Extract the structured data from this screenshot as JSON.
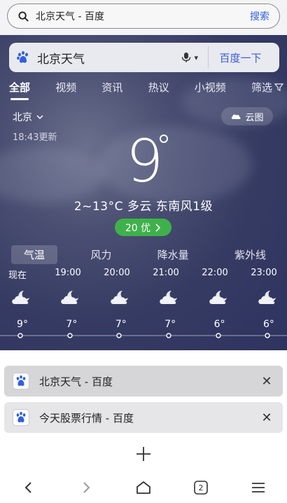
{
  "browser": {
    "address_text": "北京天气 - 百度",
    "search_label": "搜索",
    "tab_count": "2"
  },
  "baidu": {
    "query": "北京天气",
    "search_button": "百度一下",
    "tabs": [
      "全部",
      "视频",
      "资讯",
      "热议",
      "小视频",
      "筛选"
    ],
    "active_tab": "全部"
  },
  "weather": {
    "city": "北京",
    "updated": "18:43更新",
    "cloud_map": "云图",
    "temperature": "9",
    "condition": "2~13°C  多云  东南风1级",
    "aqi": "20 优",
    "metric_tabs": [
      "气温",
      "风力",
      "降水量",
      "紫外线"
    ],
    "active_metric": "气温",
    "hourly": [
      {
        "time": "现在",
        "temp": "9°"
      },
      {
        "time": "19:00",
        "temp": "7°"
      },
      {
        "time": "20:00",
        "temp": "7°"
      },
      {
        "time": "21:00",
        "temp": "7°"
      },
      {
        "time": "22:00",
        "temp": "6°"
      },
      {
        "time": "23:00",
        "temp": "6°"
      }
    ]
  },
  "open_tabs": [
    {
      "title": "北京天气 - 百度"
    },
    {
      "title": "今天股票行情 - 百度"
    }
  ],
  "colors": {
    "accent_blue": "#2f5fe0",
    "aqi_green": "#3fb14b",
    "page_bg": "#363b63"
  }
}
